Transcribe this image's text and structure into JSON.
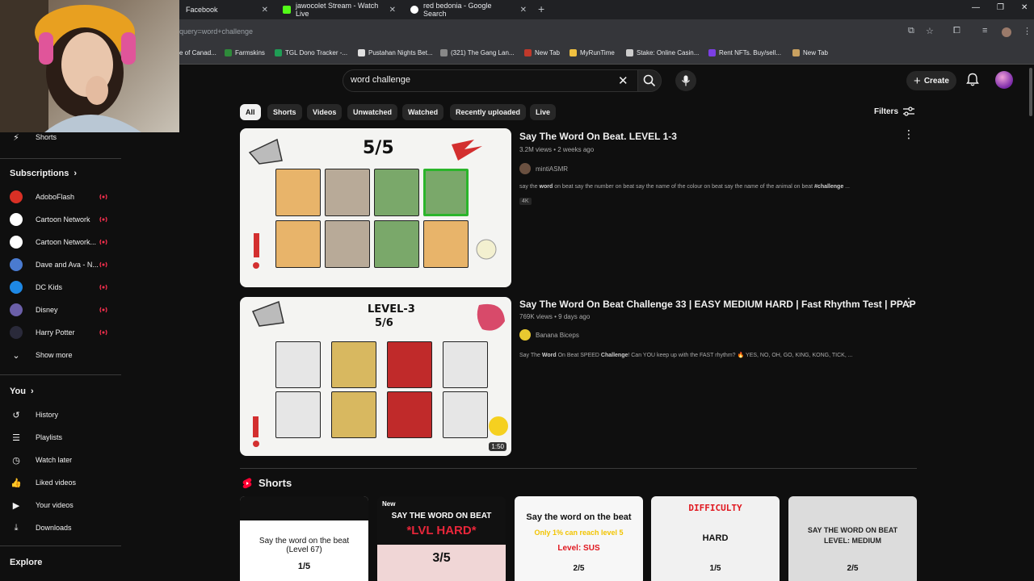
{
  "browser": {
    "tabs": [
      {
        "title": "Facebook",
        "close": "✕"
      },
      {
        "title": "jawocolet Stream - Watch Live",
        "close": "✕"
      },
      {
        "title": "red bedonia - Google Search",
        "close": "✕"
      }
    ],
    "new_tab": "+",
    "url": "query=word+challenge",
    "bookmarks": [
      "e of Canad...",
      "Farmskins",
      "TGL Dono Tracker -...",
      "Pustahan Nights Bet...",
      "(321) The Gang Lan...",
      "New Tab",
      "MyRunTime",
      "Stake: Online Casin...",
      "Rent NFTs. Buy/sell...",
      "New Tab"
    ]
  },
  "header": {
    "search_value": "word challenge",
    "create_label": "Create"
  },
  "chips": [
    "All",
    "Shorts",
    "Videos",
    "Unwatched",
    "Watched",
    "Recently uploaded",
    "Live"
  ],
  "filters_label": "Filters",
  "sidebar": {
    "shorts_label": "Shorts",
    "subscriptions_heading": "Subscriptions",
    "subscriptions": [
      {
        "name": "AdoboFlash",
        "color": "#d93025"
      },
      {
        "name": "Cartoon Network",
        "color": "#ffffff"
      },
      {
        "name": "Cartoon Network...",
        "color": "#ffffff"
      },
      {
        "name": "Dave and Ava - N...",
        "color": "#4a7bd0"
      },
      {
        "name": "DC Kids",
        "color": "#1e88e5"
      },
      {
        "name": "Disney",
        "color": "#6b5fa8"
      },
      {
        "name": "Harry Potter",
        "color": "#2a2a3a"
      }
    ],
    "show_more": "Show more",
    "you_heading": "You",
    "you_items": [
      "History",
      "Playlists",
      "Watch later",
      "Liked videos",
      "Your videos",
      "Downloads"
    ],
    "explore_heading": "Explore"
  },
  "videos": [
    {
      "title": "Say The Word On Beat. LEVEL 1-3",
      "meta": "3.2M views • 2 weeks ago",
      "channel": "mintiASMR",
      "desc_pre": "say the ",
      "desc_b1": "word",
      "desc_mid": " on beat say the number on beat say the name of the colour on beat say the name of the animal on beat ",
      "desc_b2": "#challenge",
      "desc_post": " ...",
      "badge": "4K",
      "thumb_text": "5/5"
    },
    {
      "title": "Say The Word On Beat Challenge 33 | EASY MEDIUM HARD | Fast Rhythm Test | PPAP",
      "meta": "769K views • 9 days ago",
      "channel": "Banana Biceps",
      "desc_pre": "Say The ",
      "desc_b1": "Word",
      "desc_mid": " On Beat SPEED ",
      "desc_b2": "Challenge",
      "desc_post": "! Can YOU keep up with the FAST rhythm? 🔥 YES, NO, OH, GO, KING, KONG, TICK, ...",
      "thumb_level": "LEVEL-3",
      "thumb_text": "5/6",
      "duration": "1:50"
    }
  ],
  "shorts": {
    "heading": "Shorts",
    "items": [
      {
        "line1": "Say the word on the beat",
        "line2": "(Level 67)",
        "fraction": "1/5",
        "badge": ""
      },
      {
        "line1": "SAY THE WORD ON BEAT",
        "line2": "*LVL HARD*",
        "fraction": "3/5",
        "badge": "New"
      },
      {
        "line1": "Say the word on the beat",
        "line2": "Only 1% can reach level 5",
        "line3": "Level: SUS",
        "fraction": "2/5",
        "badge": ""
      },
      {
        "line1": "DIFFICULTY",
        "line2": "HARD",
        "fraction": "1/5",
        "badge": ""
      },
      {
        "line1": "SAY THE WORD ON BEAT",
        "line2": "LEVEL: MEDIUM",
        "fraction": "2/5",
        "badge": ""
      }
    ]
  }
}
